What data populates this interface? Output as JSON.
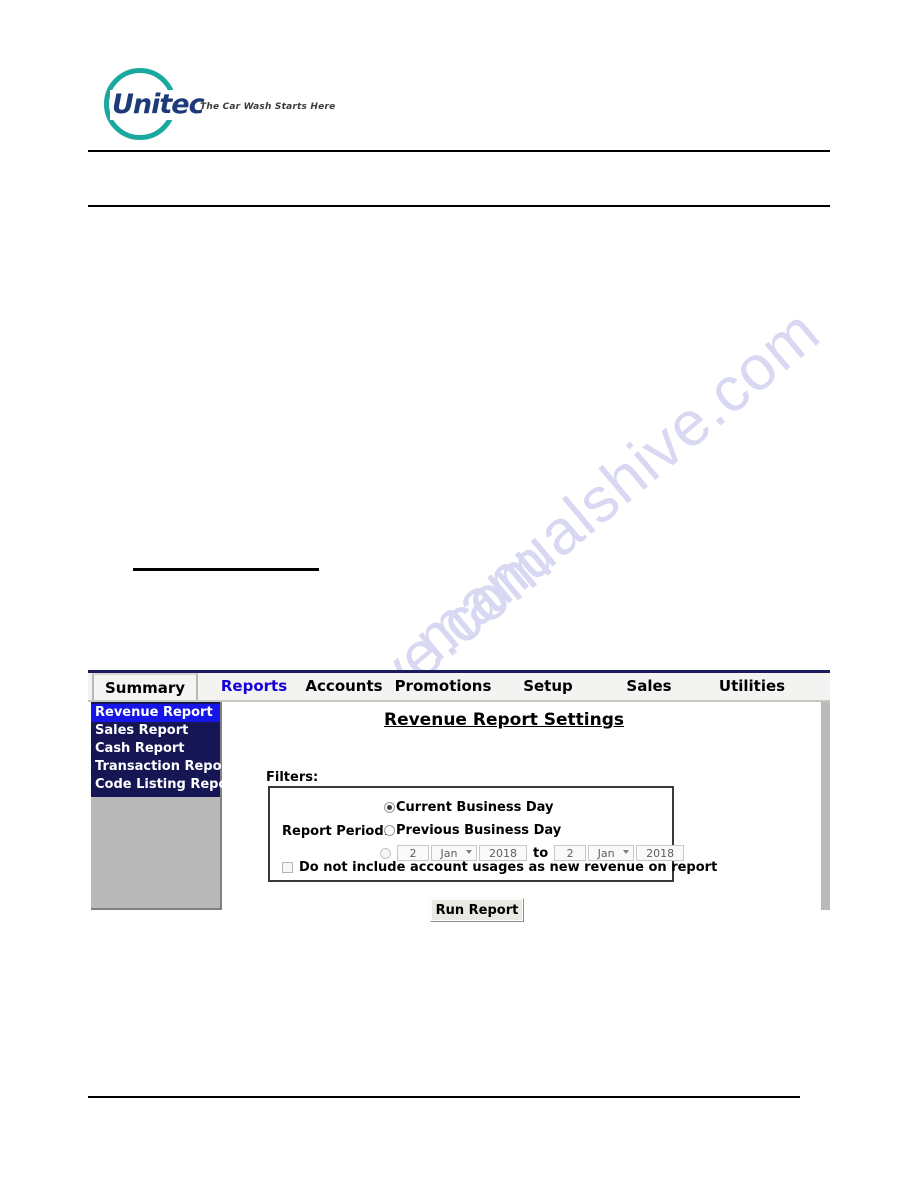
{
  "page": {
    "watermark": "manualshive.com"
  },
  "header": {
    "logo_word": "Unitec",
    "logo_tagline": "The Car Wash Starts Here",
    "logo_ring_color": "#1aa8a0",
    "logo_text_color": "#1d3a7a"
  },
  "app": {
    "tabs": [
      {
        "label": "Summary",
        "active": false
      },
      {
        "label": "Reports",
        "active": true
      },
      {
        "label": "Accounts",
        "active": false
      },
      {
        "label": "Promotions",
        "active": false
      },
      {
        "label": "Setup",
        "active": false
      },
      {
        "label": "Sales",
        "active": false
      },
      {
        "label": "Utilities",
        "active": false
      }
    ],
    "active_tab_color": "#1500d8",
    "sidebar": {
      "background": "#161654",
      "selected_background": "#1616e8",
      "items": [
        {
          "label": "Revenue Report",
          "selected": true
        },
        {
          "label": "Sales Report",
          "selected": false
        },
        {
          "label": "Cash Report",
          "selected": false
        },
        {
          "label": "Transaction Report",
          "selected": false
        },
        {
          "label": "Code Listing Report",
          "selected": false
        }
      ]
    },
    "content": {
      "title": "Revenue Report Settings",
      "filters_label": "Filters:",
      "report_period_label": "Report Period:",
      "options": [
        {
          "label": "Current Business Day",
          "selected": true
        },
        {
          "label": "Previous Business Day",
          "selected": false
        }
      ],
      "date_range": {
        "selected": false,
        "separator": "to",
        "from": {
          "day": "2",
          "month": "Jan",
          "year": "2018"
        },
        "to": {
          "day": "2",
          "month": "Jan",
          "year": "2018"
        }
      },
      "exclude_checkbox": {
        "label": "Do not include account usages as new revenue on report",
        "checked": false
      },
      "run_button_label": "Run Report"
    }
  }
}
